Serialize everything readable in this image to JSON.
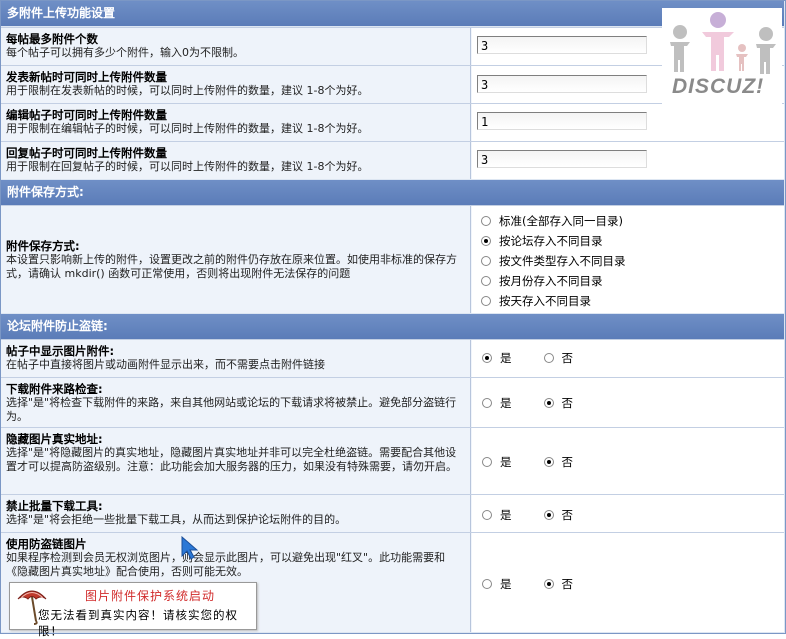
{
  "brand": {
    "logo_text": "DISCUZ!"
  },
  "sections": [
    {
      "title": "多附件上传功能设置"
    },
    {
      "title": "附件保存方式:"
    },
    {
      "title": "论坛附件防止盗链:"
    }
  ],
  "upload_settings": [
    {
      "title": "每帖最多附件个数",
      "desc": "每个帖子可以拥有多少个附件，输入0为不限制。",
      "value": "3"
    },
    {
      "title": "发表新帖时可同时上传附件数量",
      "desc": "用于限制在发表新帖的时候，可以同时上传附件的数量，建议 1-8个为好。",
      "value": "3"
    },
    {
      "title": "编辑帖子时可同时上传附件数量",
      "desc": "用于限制在编辑帖子的时候，可以同时上传附件的数量，建议 1-8个为好。",
      "value": "1"
    },
    {
      "title": "回复帖子时可同时上传附件数量",
      "desc": "用于限制在回复帖子的时候，可以同时上传附件的数量，建议 1-8个为好。",
      "value": "3"
    }
  ],
  "save_method": {
    "title": "附件保存方式:",
    "desc": "本设置只影响新上传的附件，设置更改之前的附件仍存放在原来位置。如使用非标准的保存方式，请确认 mkdir() 函数可正常使用，否则将出现附件无法保存的问题",
    "options": [
      {
        "label": "标准(全部存入同一目录)",
        "selected": false
      },
      {
        "label": "按论坛存入不同目录",
        "selected": true
      },
      {
        "label": "按文件类型存入不同目录",
        "selected": false
      },
      {
        "label": "按月份存入不同目录",
        "selected": false
      },
      {
        "label": "按天存入不同目录",
        "selected": false
      }
    ]
  },
  "yes_label": "是",
  "no_label": "否",
  "antileech": [
    {
      "title": "帖子中显示图片附件:",
      "desc": "在帖子中直接将图片或动画附件显示出来，而不需要点击附件链接",
      "value": "yes"
    },
    {
      "title": "下载附件来路检查:",
      "desc": "选择\"是\"将检查下载附件的来路，来自其他网站或论坛的下载请求将被禁止。避免部分盗链行为。",
      "value": "no"
    },
    {
      "title": "隐藏图片真实地址:",
      "desc": "选择\"是\"将隐藏图片的真实地址，隐藏图片真实地址并非可以完全杜绝盗链。需要配合其他设置才可以提高防盗级别。注意：此功能会加大服务器的压力，如果没有特殊需要，请勿开启。",
      "value": "no"
    },
    {
      "title": "禁止批量下载工具:",
      "desc": "选择\"是\"将会拒绝一些批量下载工具，从而达到保护论坛附件的目的。",
      "value": "no"
    },
    {
      "title": "使用防盗链图片",
      "desc": "如果程序检测到会员无权浏览图片，则会显示此图片，可以避免出现\"红叉\"。此功能需要和《隐藏图片真实地址》配合使用，否则可能无效。",
      "value": "no"
    }
  ],
  "popup": {
    "title": "图片附件保护系统启动",
    "body": "您无法看到真实内容！请核实您的权限！"
  },
  "colors": {
    "header": "#6384bf",
    "row": "#eef3fa",
    "border": "#7b97c5",
    "popup_title": "#d12b2b"
  }
}
